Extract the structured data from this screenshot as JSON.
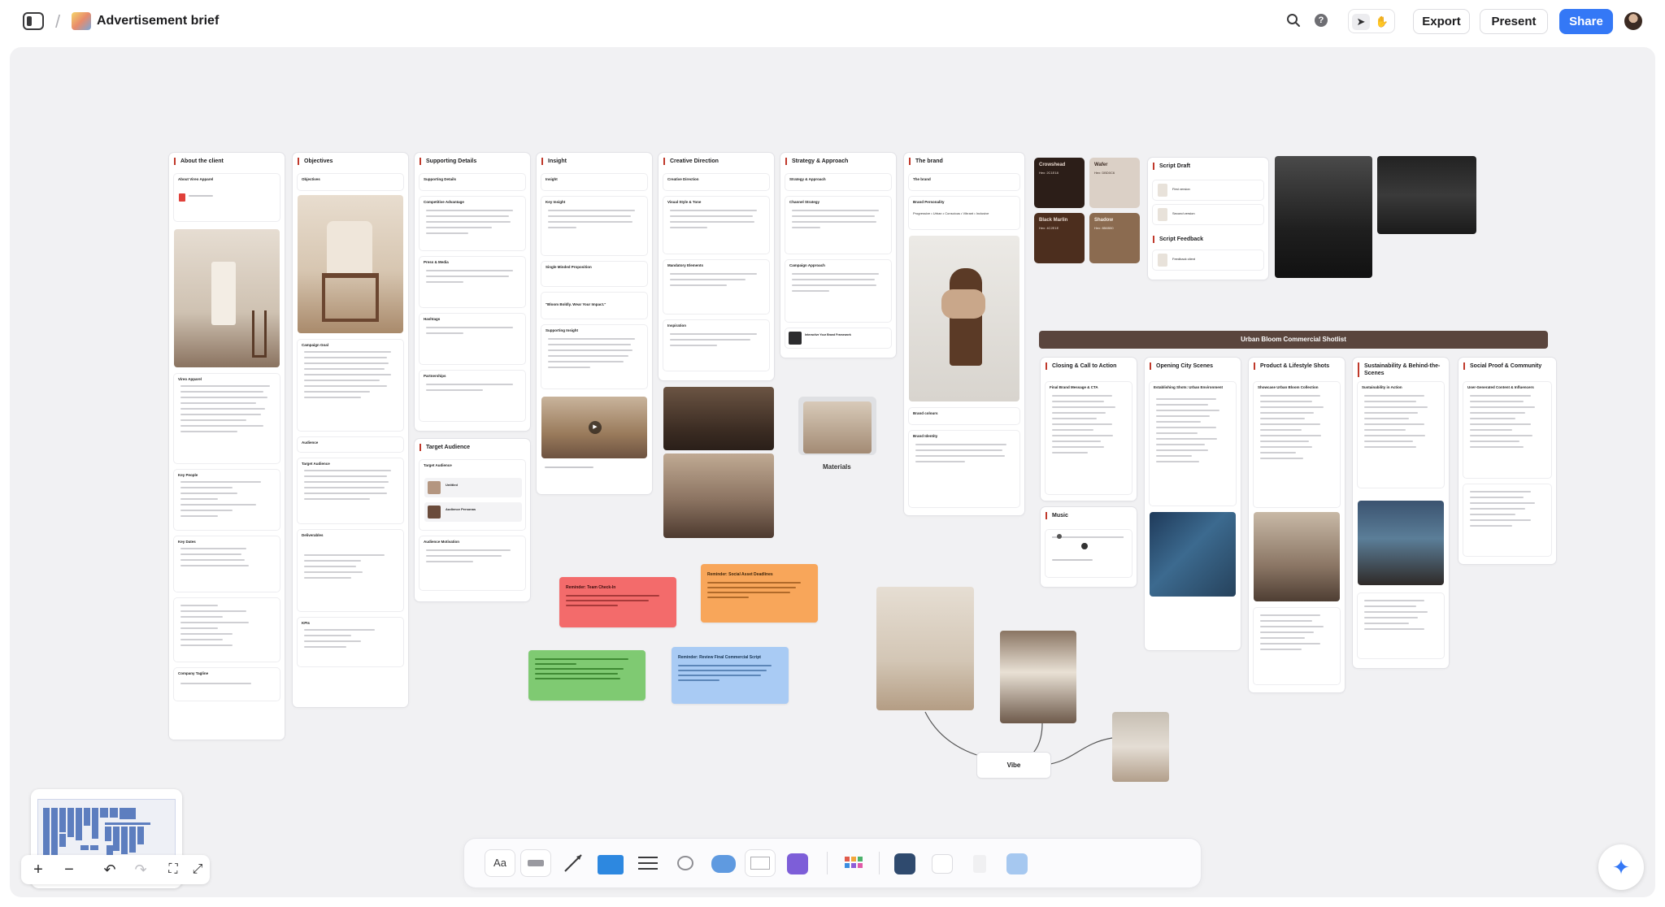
{
  "header": {
    "title": "Advertisement brief",
    "export_label": "Export",
    "present_label": "Present",
    "share_label": "Share",
    "accent": "#3478f6"
  },
  "board": {
    "columns": [
      {
        "title": "About the client",
        "sections": [
          "About Vireo Apparel",
          "Vireo Apparel",
          "Key People",
          "Key Dates",
          "Company Tagline"
        ]
      },
      {
        "title": "Objectives",
        "sections": [
          "Objectives",
          "Campaign Goal",
          "Audience",
          "Target Audience",
          "Deliverables",
          "KPIs"
        ]
      },
      {
        "title": "Supporting Details",
        "sections": [
          "Supporting Details",
          "Competitive Advantage",
          "Press & Media",
          "Hashtags",
          "Partnerships"
        ]
      },
      {
        "title": "Insight",
        "sections": [
          "Insight",
          "Key Insight",
          "Single Minded Proposition",
          "\"Bloom Boldly. Wear Your Impact.\"",
          "Supporting Insight"
        ]
      },
      {
        "title": "Creative Direction",
        "sections": [
          "Creative Direction",
          "Visual Style & Tone",
          "Mandatory Elements",
          "Inspiration"
        ]
      },
      {
        "title": "Strategy & Approach",
        "sections": [
          "Strategy & Approach",
          "Channel Strategy",
          "Campaign Approach"
        ]
      },
      {
        "title": "The brand",
        "sections": [
          "The brand",
          "Brand Personality",
          "Brand colours",
          "Brand Identity"
        ]
      }
    ],
    "brand_personality": "Progressive • Urban • Conscious • Vibrant • Inclusive",
    "target_audience_card": {
      "title": "Target Audience",
      "sub": "Target Audience",
      "items": [
        "Untitled",
        "Audience Personas"
      ],
      "footer": "Audience Motivation"
    },
    "swatches": [
      {
        "name": "Crowshead",
        "hex": "Hex: 2C1E18",
        "color": "#2c1e18",
        "text": "#e8d9cf"
      },
      {
        "name": "Wafer",
        "hex": "Hex: DBD0C6",
        "color": "#dbd0c6",
        "text": "#3b2a22"
      },
      {
        "name": "Black Marlin",
        "hex": "Hex: 4C2E1E",
        "color": "#4c2e1e",
        "text": "#e8d9cf"
      },
      {
        "name": "Shadow",
        "hex": "Hex: 8B6B50",
        "color": "#8b6b50",
        "text": "#f4ebe2"
      }
    ],
    "script_draft": {
      "title": "Script Draft",
      "items": [
        "First version",
        "Second version"
      ]
    },
    "script_feedback": {
      "title": "Script Feedback",
      "items": [
        "Feedback client"
      ]
    },
    "shotlist_title": "Urban Bloom Commercial Shotlist",
    "shotlist_columns": [
      {
        "title": "Closing & Call to Action",
        "sub": "Final Brand Message & CTA"
      },
      {
        "title": "Opening City Scenes",
        "sub": "Establishing Shots: Urban Environment"
      },
      {
        "title": "Product & Lifestyle Shots",
        "sub": "Showcase Urban Bloom Collection"
      },
      {
        "title": "Sustainability & Behind-the-Scenes",
        "sub": "Sustainability in Action"
      },
      {
        "title": "Social Proof & Community",
        "sub": "User-Generated Content & Influencers"
      }
    ],
    "music_card": {
      "title": "Music"
    },
    "materials_label": "Materials",
    "vibe_label": "Vibe",
    "strategy_link": "Interactive Your Brand Framework",
    "stickies": [
      {
        "title": "Reminder: Team Check-In",
        "color": "#f36b6b"
      },
      {
        "title": "Reminder: Social Asset Deadlines",
        "color": "#f8a65a"
      },
      {
        "title": "",
        "color": "#7fca72"
      },
      {
        "title": "Reminder: Review Final Commercial Script",
        "color": "#a9cbf4"
      }
    ]
  },
  "toolbar": {
    "text_tool": "Aa"
  }
}
